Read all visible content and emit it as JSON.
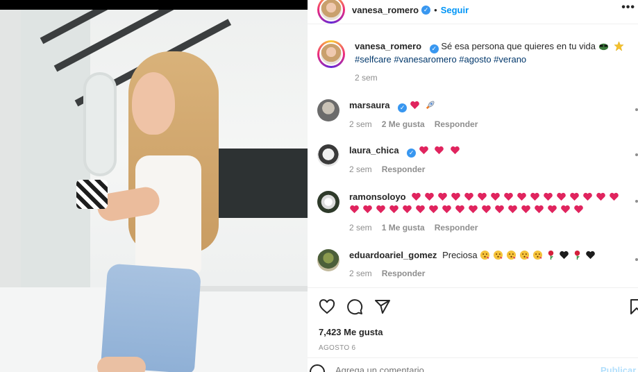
{
  "post": {
    "author": "vanesa_romero",
    "follow_label": "Seguir",
    "dot": "•",
    "more_label": "•••"
  },
  "caption": {
    "author": "vanesa_romero",
    "text": "Sé esa persona que quieres en tu vida",
    "hashtags": "#selfcare #vanesaromero #agosto #verano",
    "time": "2 sem"
  },
  "comments": [
    {
      "author": "marsaura",
      "text": "",
      "time": "2 sem",
      "likes": "2 Me gusta",
      "reply": "Responder"
    },
    {
      "author": "laura_chica",
      "text": "",
      "time": "2 sem",
      "likes": "",
      "reply": "Responder"
    },
    {
      "author": "ramonsoloyo",
      "text": "",
      "time": "2 sem",
      "likes": "1 Me gusta",
      "reply": "Responder"
    },
    {
      "author": "eduardoariel_gomez",
      "text": "Preciosa",
      "time": "2 sem",
      "likes": "",
      "reply": "Responder"
    }
  ],
  "stats": {
    "likes": "7,423 Me gusta",
    "date": "AGOSTO 6"
  },
  "composer": {
    "placeholder": "Agrega un comentario...",
    "publish_label": "Publicar"
  },
  "icons": {
    "like": "heart-icon",
    "comment": "comment-icon",
    "share": "paper-plane-icon",
    "save": "bookmark-icon",
    "verified": "verified-badge-icon",
    "emoji": "smiley-icon"
  },
  "colors": {
    "link": "#0095f6",
    "hashtag": "#00376b",
    "muted": "#8e8e8e",
    "heart": "#ed4956"
  }
}
